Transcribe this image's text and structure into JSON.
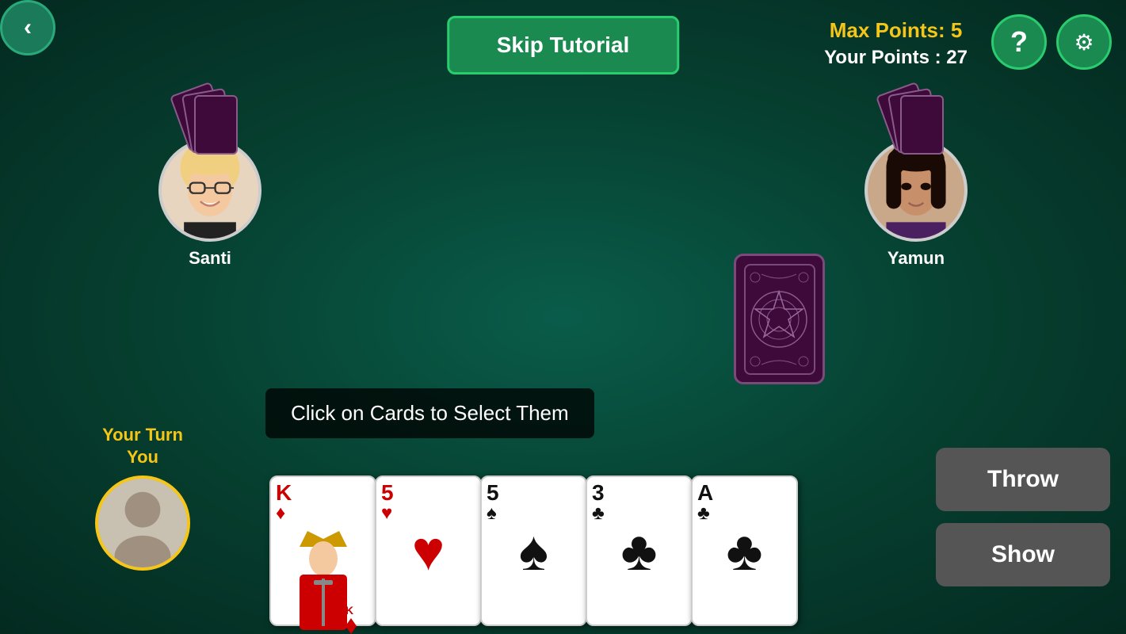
{
  "header": {
    "back_label": "‹",
    "skip_tutorial_label": "Skip Tutorial",
    "max_points_label": "Max Points: 5",
    "your_points_label": "Your Points : 27",
    "help_label": "?",
    "settings_label": "⚙"
  },
  "players": {
    "left": {
      "name": "Santi"
    },
    "right": {
      "name": "Yamun"
    },
    "you": {
      "turn_label": "Your Turn\nYou"
    }
  },
  "tooltip": {
    "text": "Click on Cards to Select Them"
  },
  "hand": {
    "cards": [
      {
        "rank": "K",
        "suit": "♦",
        "color": "red",
        "label": "King of Diamonds"
      },
      {
        "rank": "5",
        "suit": "♥",
        "color": "red",
        "label": "Five of Hearts"
      },
      {
        "rank": "5",
        "suit": "♠",
        "color": "black",
        "label": "Five of Spades"
      },
      {
        "rank": "3",
        "suit": "♣",
        "color": "black",
        "label": "Three of Clubs"
      },
      {
        "rank": "A",
        "suit": "♣",
        "color": "black",
        "label": "Ace of Clubs"
      }
    ]
  },
  "actions": {
    "throw_label": "Throw",
    "show_label": "Show"
  }
}
